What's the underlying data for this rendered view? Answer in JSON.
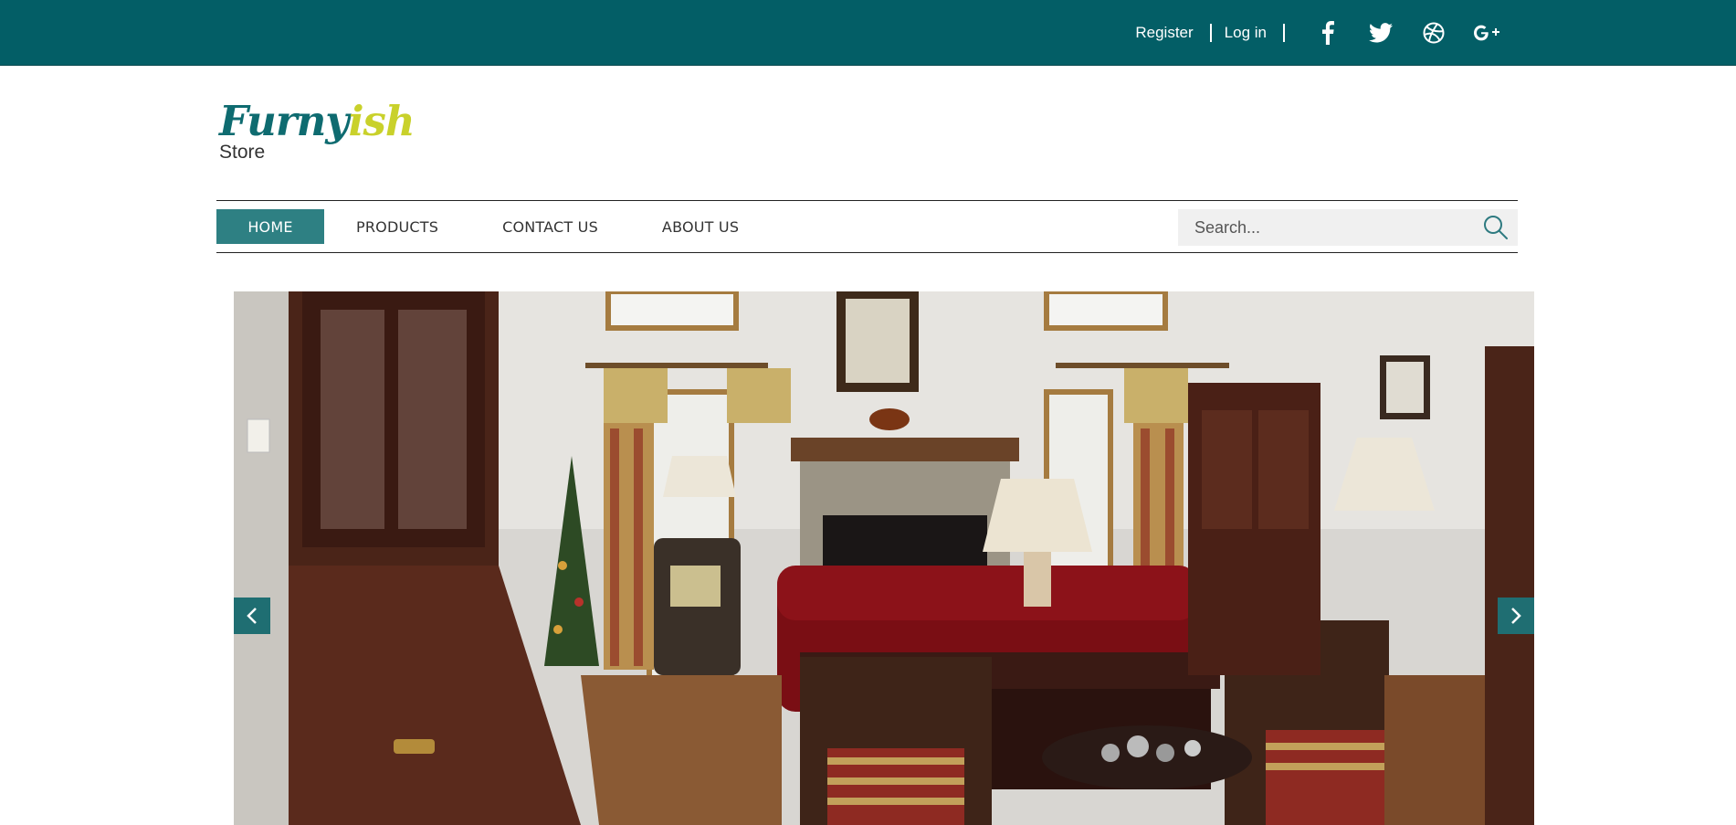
{
  "topbar": {
    "register_label": "Register",
    "login_label": "Log in",
    "social": [
      "facebook-icon",
      "twitter-icon",
      "dribbble-icon",
      "google-plus-icon"
    ],
    "background_color": "#035e66"
  },
  "logo": {
    "word_part1": "Furny",
    "word_part2": "ish",
    "subtitle": "Store"
  },
  "nav": {
    "items": [
      {
        "label": "HOME",
        "active": true
      },
      {
        "label": "PRODUCTS",
        "active": false
      },
      {
        "label": "CONTACT US",
        "active": false
      },
      {
        "label": "ABOUT US",
        "active": false
      }
    ],
    "active_color": "#2e8083"
  },
  "search": {
    "placeholder": "Search...",
    "icon": "search-icon"
  },
  "slider": {
    "image_subject": "living room with red sofa, fireplace and wooden furniture",
    "prev_icon": "chevron-left-icon",
    "next_icon": "chevron-right-icon",
    "arrow_color": "#1f6e72"
  }
}
